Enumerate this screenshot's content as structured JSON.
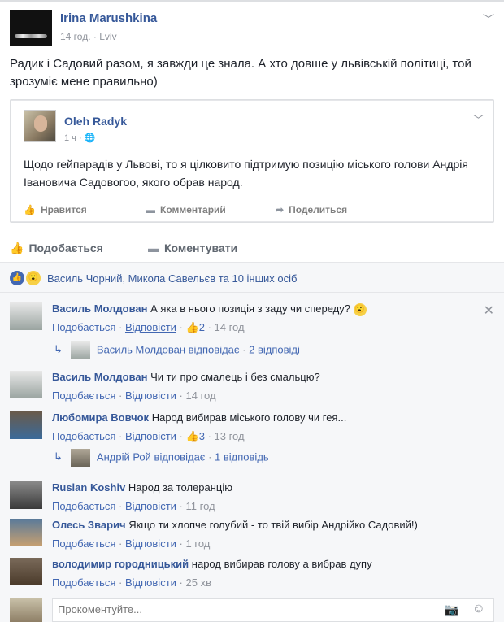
{
  "post": {
    "author": "Irina Marushkina",
    "time": "14 год.",
    "separator": "·",
    "location": "Lviv",
    "text": "Радик і Садовий разом, я завжди це знала. А хто довше у львівській політиці, той зрозуміє мене правильно)"
  },
  "shared": {
    "author": "Oleh Radyk",
    "time": "1 ч",
    "text": "Щодо гейпарадів у Львові, то я цілковито підтримую позицію міського голови Андрія Івановича Садовогоо, якого обрав народ.",
    "like_label": "Нравится",
    "comment_label": "Комментарий",
    "share_label": "Поделиться"
  },
  "actions": {
    "like_label": "Подобається",
    "comment_label": "Коментувати"
  },
  "likes": {
    "summary": "Василь Чорний, Микола Савельєв та 10 інших осіб"
  },
  "comments": [
    {
      "name": "Василь Молдован",
      "text": "А яка в нього позиція з заду чи спереду?",
      "like": "Подобається",
      "reply": "Відповісти",
      "likes_count": "2",
      "time": "14 год"
    },
    {
      "name": "Василь Молдован",
      "text": "Чи ти про смалець і без смальцю?",
      "like": "Подобається",
      "reply": "Відповісти",
      "time": "14 год"
    },
    {
      "name": "Любомира Вовчок",
      "text": "Народ вибирав міського голову чи гея...",
      "like": "Подобається",
      "reply": "Відповісти",
      "likes_count": "3",
      "time": "13 год"
    },
    {
      "name": "Ruslan Koshiv",
      "text": "Народ за толеранцію",
      "like": "Подобається",
      "reply": "Відповісти",
      "time": "11 год"
    },
    {
      "name": "Олесь Зварич",
      "text": "Якщо ти хлопче голубий - то твій вибір Андрійко Садовий!)",
      "like": "Подобається",
      "reply": "Відповісти",
      "time": "1 год"
    },
    {
      "name": "володимир городницький",
      "text": "народ вибирав голову а вибрав дупу",
      "like": "Подобається",
      "reply": "Відповісти",
      "time": "25 хв"
    }
  ],
  "replies": [
    {
      "text": "Василь Молдован відповідає",
      "count": "2 відповіді"
    },
    {
      "text": "Андрій Рой відповідає",
      "count": "1 відповідь"
    }
  ],
  "meta": {
    "dot": "·"
  },
  "composer": {
    "placeholder": "Прокоментуйте..."
  }
}
